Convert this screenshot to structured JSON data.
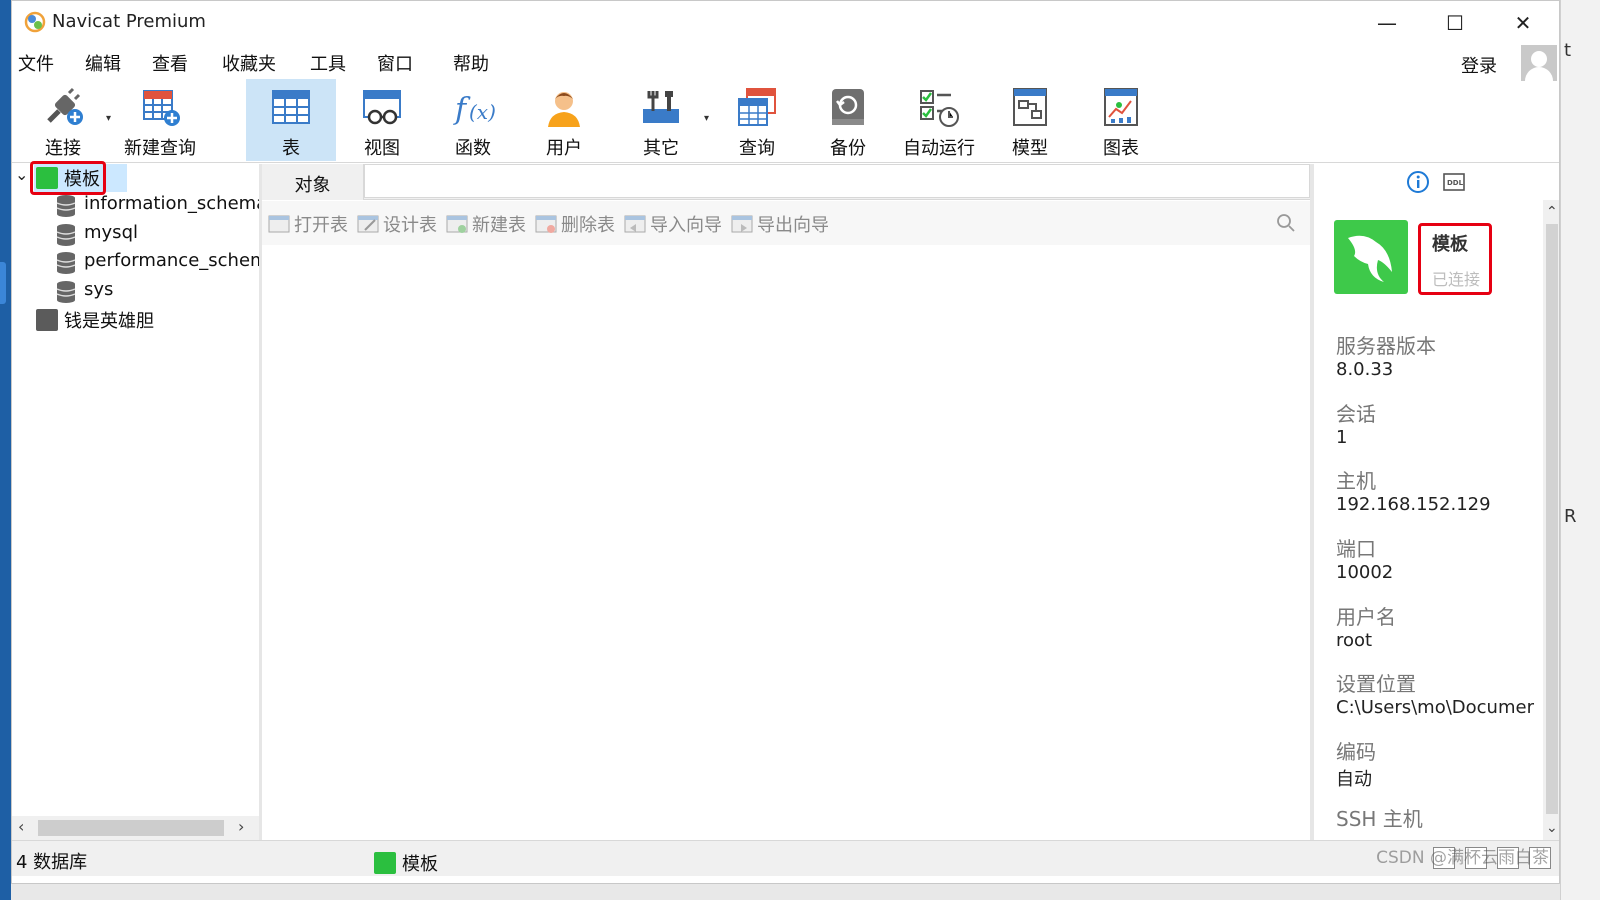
{
  "window": {
    "title": "Navicat Premium"
  },
  "menu": {
    "items": [
      "文件",
      "编辑",
      "查看",
      "收藏夹",
      "工具",
      "窗口",
      "帮助"
    ],
    "login": "登录"
  },
  "toolbar": {
    "connect": "连接",
    "new_query": "新建查询",
    "table": "表",
    "view": "视图",
    "function": "函数",
    "user": "用户",
    "other": "其它",
    "query": "查询",
    "backup": "备份",
    "automation": "自动运行",
    "model": "模型",
    "chart": "图表"
  },
  "tree": {
    "connection": "模板",
    "databases": [
      "information_schema",
      "mysql",
      "performance_schema",
      "sys"
    ],
    "other_connection": "钱是英雄胆"
  },
  "main": {
    "tab": "对象",
    "buttons": [
      "打开表",
      "设计表",
      "新建表",
      "删除表",
      "导入向导",
      "导出向导"
    ]
  },
  "info": {
    "name": "模板",
    "status": "已连接",
    "props": [
      {
        "label": "服务器版本",
        "value": "8.0.33"
      },
      {
        "label": "会话",
        "value": "1"
      },
      {
        "label": "主机",
        "value": "192.168.152.129"
      },
      {
        "label": "端口",
        "value": "10002"
      },
      {
        "label": "用户名",
        "value": "root"
      },
      {
        "label": "设置位置",
        "value": "C:\\Users\\mo\\Documer"
      },
      {
        "label": "编码",
        "value": "自动"
      },
      {
        "label": "SSH 主机",
        "value": ""
      }
    ]
  },
  "status": {
    "db_count": "4 数据库",
    "conn": "模板"
  },
  "watermark": "CSDN @满杯云雨白茶",
  "desk_right": {
    "top_char": "t",
    "mid_char": "R"
  },
  "colors": {
    "accent": "#cce4f7",
    "connected": "#2bbf3f",
    "highlight": "#e60012"
  }
}
